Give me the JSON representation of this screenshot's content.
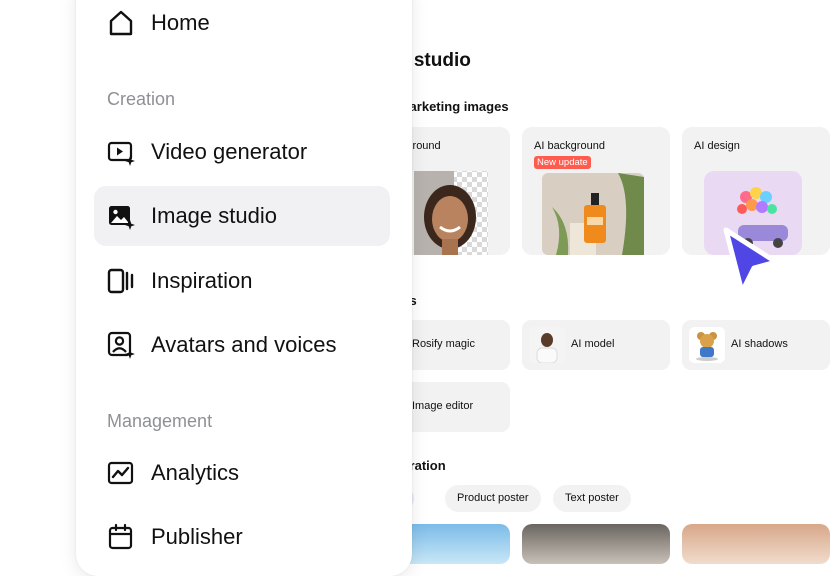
{
  "sidebar": {
    "home": "Home",
    "groups": {
      "creation": "Creation",
      "management": "Management"
    },
    "items": [
      {
        "label": "Video generator",
        "icon": "video-sparkle-icon"
      },
      {
        "label": "Image studio",
        "icon": "image-sparkle-icon",
        "active": true
      },
      {
        "label": "Inspiration",
        "icon": "inspiration-icon"
      },
      {
        "label": "Avatars and voices",
        "icon": "avatar-icon"
      },
      {
        "label": "Analytics",
        "icon": "analytics-icon"
      },
      {
        "label": "Publisher",
        "icon": "calendar-icon"
      }
    ]
  },
  "page": {
    "title": "e studio",
    "marketing_section": "marketing images",
    "cards": [
      {
        "label": "e background"
      },
      {
        "label": "AI background",
        "badge": "New update"
      },
      {
        "label": "AI design"
      }
    ],
    "tools_section": "ols",
    "tools": [
      {
        "label": "Rosify magic"
      },
      {
        "label": "AI model"
      },
      {
        "label": "AI shadows"
      },
      {
        "label": "Image editor"
      }
    ],
    "inspiration_section": "piration",
    "chips": [
      {
        "label": "ges",
        "selected": true
      },
      {
        "label": "Product poster"
      },
      {
        "label": "Text poster"
      }
    ]
  },
  "colors": {
    "accent": "#4f46e5",
    "badge": "#ff5b4e",
    "active_bg": "#f1f1f3",
    "muted_text": "#8f9095"
  }
}
